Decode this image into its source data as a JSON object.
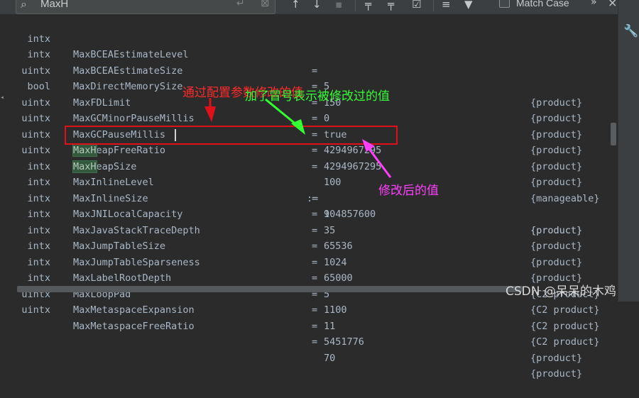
{
  "search": {
    "value": "MaxH",
    "search_icon": "search-icon",
    "return_icon": "return-icon",
    "clear_icon": "clear-icon"
  },
  "toolbar": {
    "icons": [
      "arrow-up-icon",
      "arrow-down-icon",
      "pin-icon",
      "add-selection-icon",
      "remove-selection-icon",
      "select-all-occurrences-icon",
      "in-selection-icon",
      "filter-icon"
    ],
    "match_case_label": "Match Case",
    "more_icon": "more-icon",
    "close_icon": "close-icon"
  },
  "rows": [
    {
      "type": "intx",
      "name": "MaxBCEAEstimateLevel",
      "eq": "=",
      "value": "5",
      "origin": "{product}"
    },
    {
      "type": "intx",
      "name": "MaxBCEAEstimateSize",
      "eq": "=",
      "value": "150",
      "origin": "{product}"
    },
    {
      "type": "uintx",
      "name": "MaxDirectMemorySize",
      "eq": "=",
      "value": "0",
      "origin": "{product}"
    },
    {
      "type": "bool",
      "name": "MaxFDLimit",
      "eq": "=",
      "value": "true",
      "origin": "{product}"
    },
    {
      "type": "uintx",
      "name": "MaxGCMinorPauseMillis",
      "eq": "=",
      "value": "4294967295",
      "origin": "{product}"
    },
    {
      "type": "uintx",
      "name": "MaxGCPauseMillis",
      "eq": "=",
      "value": "4294967295",
      "origin": "{product}"
    },
    {
      "type": "uintx",
      "name": "MaxHeapFreeRatio",
      "eq": "=",
      "value": "100",
      "origin": "{manageable}"
    },
    {
      "type": "uintx",
      "name": "MaxHeapSize",
      "eq": ":=",
      "value": "104857600",
      "origin": "{product}"
    },
    {
      "type": "intx",
      "name": "MaxInlineLevel",
      "eq": "=",
      "value": "9",
      "origin": "{product}"
    },
    {
      "type": "intx",
      "name": "MaxInlineSize",
      "eq": "=",
      "value": "35",
      "origin": "{product}"
    },
    {
      "type": "intx",
      "name": "MaxJNILocalCapacity",
      "eq": "=",
      "value": "65536",
      "origin": "{product}"
    },
    {
      "type": "intx",
      "name": "MaxJavaStackTraceDepth",
      "eq": "=",
      "value": "1024",
      "origin": "{product}"
    },
    {
      "type": "intx",
      "name": "MaxJumpTableSize",
      "eq": "=",
      "value": "65000",
      "origin": "{C2 product}"
    },
    {
      "type": "intx",
      "name": "MaxJumpTableSparseness",
      "eq": "=",
      "value": "5",
      "origin": "{C2 product}"
    },
    {
      "type": "intx",
      "name": "MaxLabelRootDepth",
      "eq": "=",
      "value": "1100",
      "origin": "{C2 product}"
    },
    {
      "type": "intx",
      "name": "MaxLoopPad",
      "eq": "=",
      "value": "11",
      "origin": "{C2 product}"
    },
    {
      "type": "uintx",
      "name": "MaxMetaspaceExpansion",
      "eq": "=",
      "value": "5451776",
      "origin": "{product}"
    },
    {
      "type": "uintx",
      "name": "MaxMetaspaceFreeRatio",
      "eq": "=",
      "value": "70",
      "origin": "{product}"
    }
  ],
  "annotations": {
    "red_note": "通过配置参数修改的值",
    "green_note": "加了冒号表示被修改过的值",
    "magenta_note": "修改后的值",
    "colors": {
      "red": "#e0101a",
      "green": "#33ff33",
      "magenta": "#ff40ff"
    }
  },
  "right_panel": {
    "icon": "wrench-icon"
  },
  "watermark": "CSDN @呆呆的木鸡"
}
